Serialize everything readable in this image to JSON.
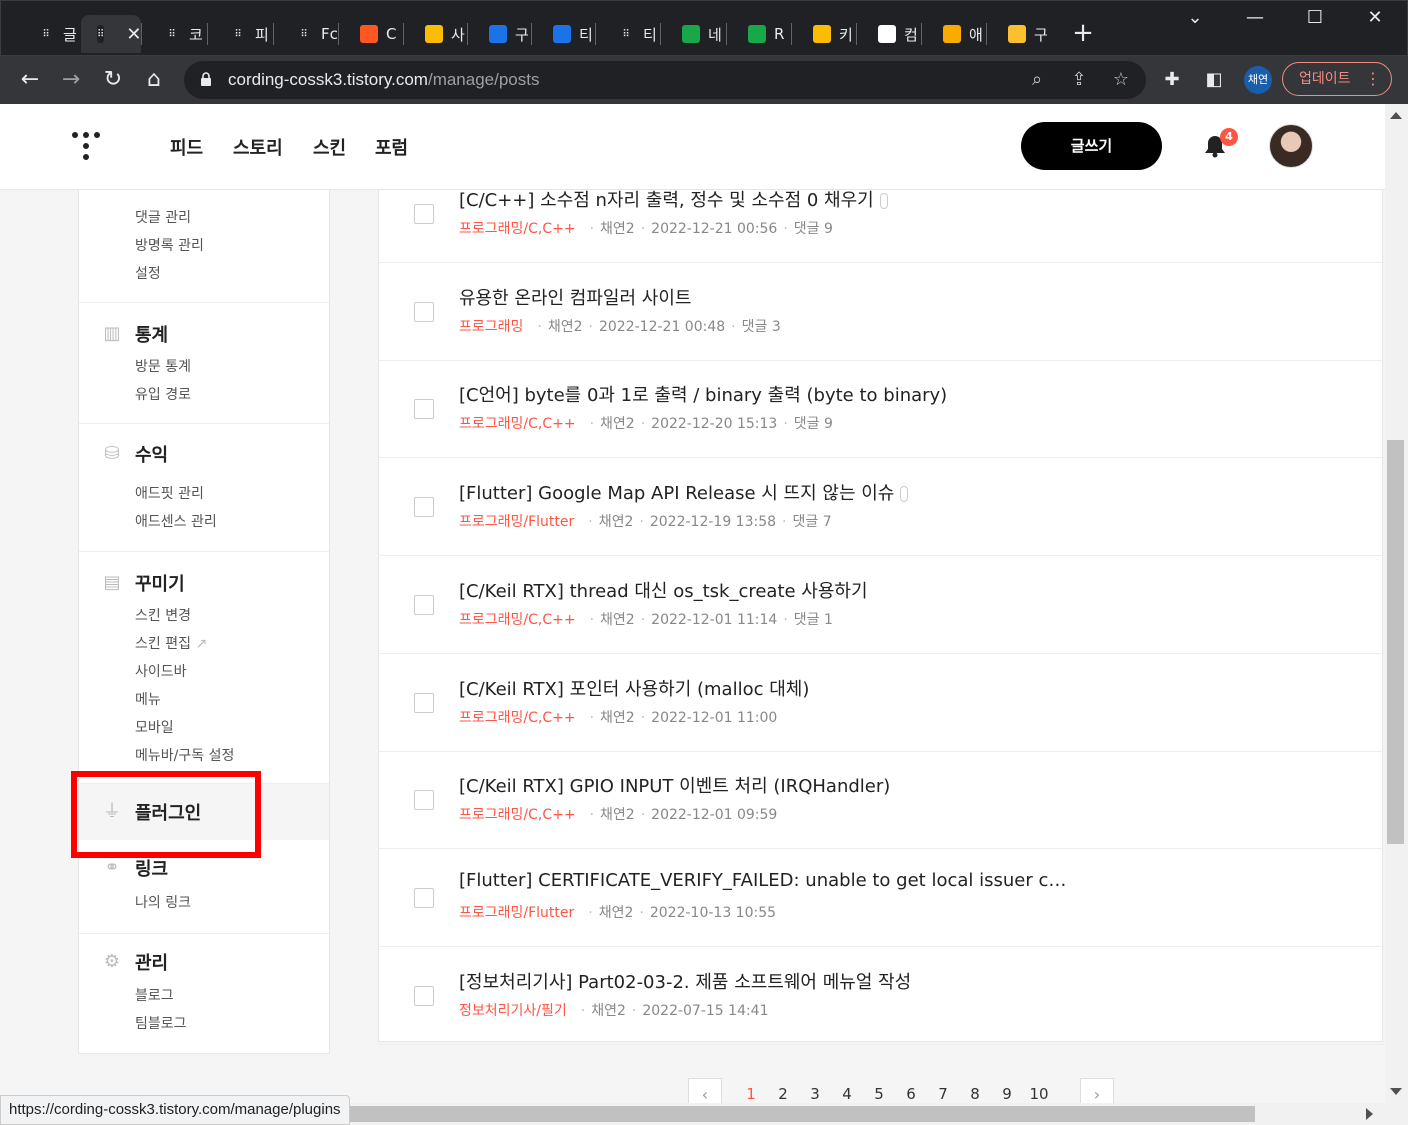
{
  "browser": {
    "tabs": [
      {
        "label": "글",
        "fav": "tistory-favicon"
      },
      {
        "label": "",
        "fav": "tistory-favicon",
        "active": true
      },
      {
        "label": "코",
        "fav": "tistory-favicon"
      },
      {
        "label": "피",
        "fav": "tistory-favicon"
      },
      {
        "label": "Fc",
        "fav": "tistory-favicon"
      },
      {
        "label": "C",
        "fav": "orange-favicon"
      },
      {
        "label": "사",
        "fav": "ads-favicon"
      },
      {
        "label": "구",
        "fav": "blue-favicon"
      },
      {
        "label": "티",
        "fav": "blue-favicon"
      },
      {
        "label": "티",
        "fav": "tistory-favicon"
      },
      {
        "label": "네",
        "fav": "green-favicon"
      },
      {
        "label": "R",
        "fav": "green-favicon"
      },
      {
        "label": "키",
        "fav": "ads-favicon"
      },
      {
        "label": "컴",
        "fav": "github-favicon"
      },
      {
        "label": "애",
        "fav": "analytics-favicon"
      },
      {
        "label": "구",
        "fav": "yellow-favicon"
      }
    ],
    "url_host": "cording-cossk3.tistory.com",
    "url_path": "/manage/posts",
    "profile_label": "채연",
    "update_label": "업데이트",
    "status_url": "https://cording-cossk3.tistory.com/manage/plugins"
  },
  "header": {
    "nav": [
      "피드",
      "스토리",
      "스킨",
      "포럼"
    ],
    "write_label": "글쓰기",
    "notification_count": "4"
  },
  "sidebar": {
    "comments_items": [
      "댓글 관리",
      "방명록 관리",
      "설정"
    ],
    "stats": {
      "title": "통계",
      "items": [
        "방문 통계",
        "유입 경로"
      ]
    },
    "revenue": {
      "title": "수익",
      "items": [
        "애드핏 관리",
        "애드센스 관리"
      ]
    },
    "decorate": {
      "title": "꾸미기",
      "items": [
        "스킨 변경",
        "스킨 편집",
        "사이드바",
        "메뉴",
        "모바일",
        "메뉴바/구독 설정"
      ]
    },
    "plugin": {
      "title": "플러그인"
    },
    "link": {
      "title": "링크",
      "items": [
        "나의 링크"
      ]
    },
    "manage": {
      "title": "관리",
      "items": [
        "블로그",
        "팀블로그"
      ]
    }
  },
  "posts": [
    {
      "title": "[C/C++] 소수점 n자리 출력, 정수 및 소수점 0 채우기",
      "category": "프로그래밍/C,C++",
      "author": "채연2",
      "date": "2022-12-21 00:56",
      "comments": "댓글 9",
      "clip": true
    },
    {
      "title": "유용한 온라인 컴파일러 사이트",
      "category": "프로그래밍",
      "author": "채연2",
      "date": "2022-12-21 00:48",
      "comments": "댓글 3",
      "clip": false
    },
    {
      "title": "[C언어] byte를 0과 1로 출력 / binary 출력 (byte to binary)",
      "category": "프로그래밍/C,C++",
      "author": "채연2",
      "date": "2022-12-20 15:13",
      "comments": "댓글 9",
      "clip": false
    },
    {
      "title": "[Flutter] Google Map API Release 시 뜨지 않는 이슈",
      "category": "프로그래밍/Flutter",
      "author": "채연2",
      "date": "2022-12-19 13:58",
      "comments": "댓글 7",
      "clip": true
    },
    {
      "title": "[C/Keil RTX] thread 대신 os_tsk_create 사용하기",
      "category": "프로그래밍/C,C++",
      "author": "채연2",
      "date": "2022-12-01 11:14",
      "comments": "댓글 1",
      "clip": false
    },
    {
      "title": "[C/Keil RTX] 포인터 사용하기 (malloc 대체)",
      "category": "프로그래밍/C,C++",
      "author": "채연2",
      "date": "2022-12-01 11:00",
      "comments": "",
      "clip": false
    },
    {
      "title": "[C/Keil RTX] GPIO INPUT 이벤트 처리 (IRQHandler)",
      "category": "프로그래밍/C,C++",
      "author": "채연2",
      "date": "2022-12-01 09:59",
      "comments": "",
      "clip": false
    },
    {
      "title": "[Flutter] CERTIFICATE_VERIFY_FAILED: unable to get local issuer c…",
      "category": "프로그래밍/Flutter",
      "author": "채연2",
      "date": "2022-10-13 10:55",
      "comments": "",
      "clip": false
    },
    {
      "title": "[정보처리기사] Part02-03-2. 제품 소프트웨어 메뉴얼 작성",
      "category": "정보처리기사/필기",
      "author": "채연2",
      "date": "2022-07-15 14:41",
      "comments": "",
      "clip": false
    }
  ],
  "pagination": {
    "pages": [
      "1",
      "2",
      "3",
      "4",
      "5",
      "6",
      "7",
      "8",
      "9",
      "10"
    ],
    "current": "1",
    "prev": "‹",
    "next": "›"
  },
  "colors": {
    "accent": "#ff5544",
    "highlight_box": "#ff0000",
    "chrome_dark": "#202124"
  }
}
